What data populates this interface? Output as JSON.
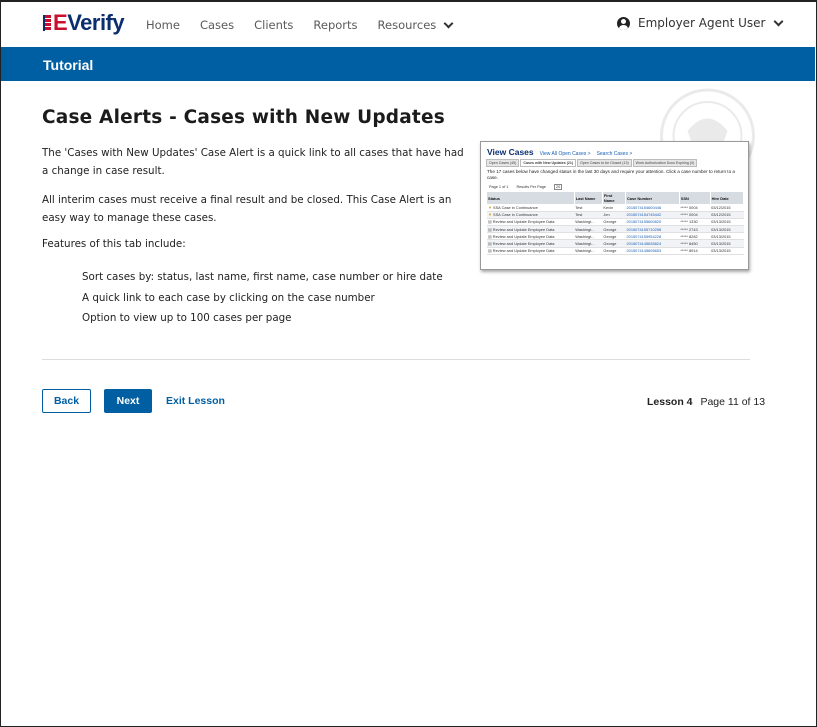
{
  "header": {
    "logo_e": "E",
    "logo_verify": "Verify",
    "nav": [
      "Home",
      "Cases",
      "Clients",
      "Reports"
    ],
    "resources_label": "Resources",
    "user_label": "Employer Agent User"
  },
  "banner": {
    "title": "Tutorial"
  },
  "content": {
    "title": "Case Alerts - Cases with New Updates",
    "p1": "The 'Cases with New Updates' Case Alert is a quick link to all cases that have had a change in case result.",
    "p2": "All interim cases must receive a final result and be closed. This Case Alert is an easy way to manage these cases.",
    "p3": "Features of this tab include:",
    "features": [
      "Sort cases by: status, last name, first name, case number or hire date",
      "A quick link to each case by clicking on the case number",
      "Option to view up to 100 cases per page"
    ]
  },
  "thumbnail": {
    "title": "View Cases",
    "link1": "View All Open Cases >",
    "link2": "Search Cases >",
    "tabs": [
      "Open Cases (45)",
      "Cases with New Updates (21)",
      "Open Cases to be Closed (13)",
      "Work Authorization Docs Expiring (0)"
    ],
    "desc": "The 17 cases below have changed status in the last 30 days and require your attention. Click a case number to return to a case.",
    "pager": "Page 1 of 1",
    "results_label": "Results Per Page",
    "results_value": "20",
    "columns": [
      "Status",
      "Last Name",
      "First Name",
      "Case Number",
      "SSN",
      "Hire Date"
    ],
    "rows": [
      [
        "SSA Case in Continuance",
        "Test",
        "Kevin",
        "2015074154600446",
        "***** 0004",
        "03/12/2015"
      ],
      [
        "SSA Case in Continuance",
        "Test",
        "Jen",
        "2015074154745442",
        "***** 0004",
        "03/12/2015"
      ],
      [
        "Review and Update Employee Data",
        "Washingt...",
        "George",
        "2015074155600820",
        "***** 1330",
        "03/13/2015"
      ],
      [
        "Review and Update Employee Data",
        "Washingt...",
        "George",
        "2015074155710258",
        "***** 2743",
        "03/13/2015"
      ],
      [
        "Review and Update Employee Data",
        "Washingt...",
        "George",
        "2015074155954228",
        "***** 8282",
        "03/13/2015"
      ],
      [
        "Review and Update Employee Data",
        "Washingt...",
        "George",
        "2015074145635824",
        "***** 8450",
        "03/13/2015"
      ],
      [
        "Review and Update Employee Data",
        "Washingt...",
        "George",
        "2015074145605653",
        "***** 8914",
        "03/13/2015"
      ]
    ]
  },
  "footer": {
    "back_label": "Back",
    "next_label": "Next",
    "exit_label": "Exit Lesson",
    "lesson_label": "Lesson 4",
    "page_label": "Page 11 of 13"
  }
}
